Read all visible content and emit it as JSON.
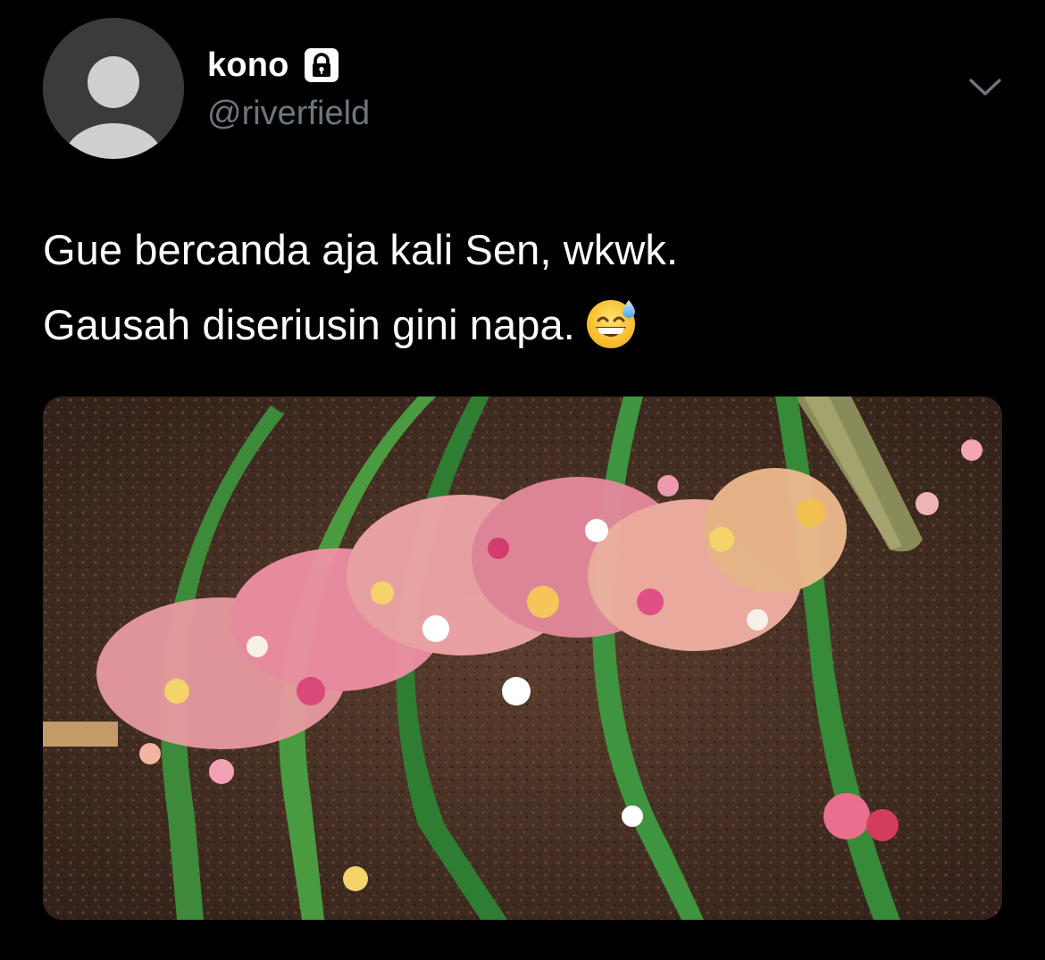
{
  "tweet": {
    "author": {
      "display_name": "kono",
      "handle": "@riverfield",
      "protected_icon": "lock-icon",
      "avatar": "default-avatar"
    },
    "menu_icon": "chevron-down-icon",
    "text_lines": [
      "Gue bercanda aja kali Sen, wkwk.",
      "Gausah diseriusin gini napa."
    ],
    "emoji": "😅",
    "media": {
      "subject": "flower petals on soil"
    }
  },
  "colors": {
    "background": "#000000",
    "primary_text": "#ffffff",
    "secondary_text": "#6e767d",
    "avatar_bg": "#3b3b3d",
    "avatar_fg": "#cfcfd1"
  }
}
